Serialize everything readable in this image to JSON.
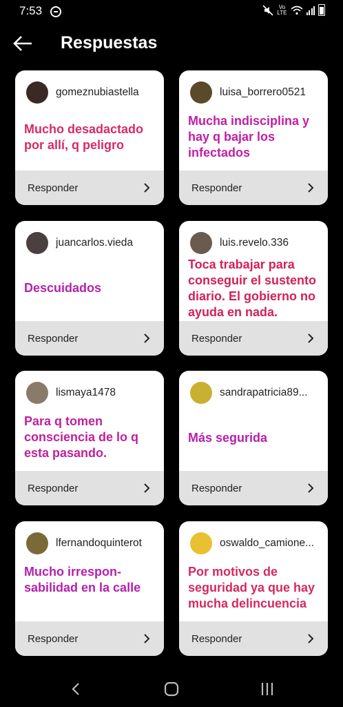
{
  "status_bar": {
    "time": "7:53",
    "lte_top": "Vo",
    "lte_bottom": "LTE"
  },
  "header": {
    "title": "Respuestas"
  },
  "reply_label": "Responder",
  "cards": [
    {
      "username": "gomeznubiastella",
      "text": "Mucho desadactado por allí, q peligro",
      "color": "#d62a6a",
      "avatar": "#3a2a25"
    },
    {
      "username": "luisa_borrero0521",
      "text": "Mucha indisciplina y hay q bajar los infectados",
      "color": "#c01fa6",
      "avatar": "#5a4a2a"
    },
    {
      "username": "juancarlos.vieda",
      "text": "Descuidados",
      "color": "#b521ad",
      "avatar": "#4a4040"
    },
    {
      "username": "luis.revelo.336",
      "text": "Toca trabajar para conseguir el sustento diario. El gobierno no ayuda en nada.",
      "color": "#d22256",
      "avatar": "#6a5a50"
    },
    {
      "username": "lismaya1478",
      "text": "Para q tomen consciencia de lo q esta pasando.",
      "color": "#c0219a",
      "avatar": "#8a7a6a"
    },
    {
      "username": "sandrapatricia89...",
      "text": "Más segurida",
      "color": "#b521ad",
      "avatar": "#c9b030"
    },
    {
      "username": "lfernandoquinterot",
      "text": "Mucho irrespon-sabilidad en la calle",
      "color": "#b521ad",
      "avatar": "#7a6a3a"
    },
    {
      "username": "oswaldo_camione...",
      "text": "Por motivos de seguridad ya que hay mucha delincuencia",
      "color": "#d42a60",
      "avatar": "#e8c030"
    }
  ]
}
